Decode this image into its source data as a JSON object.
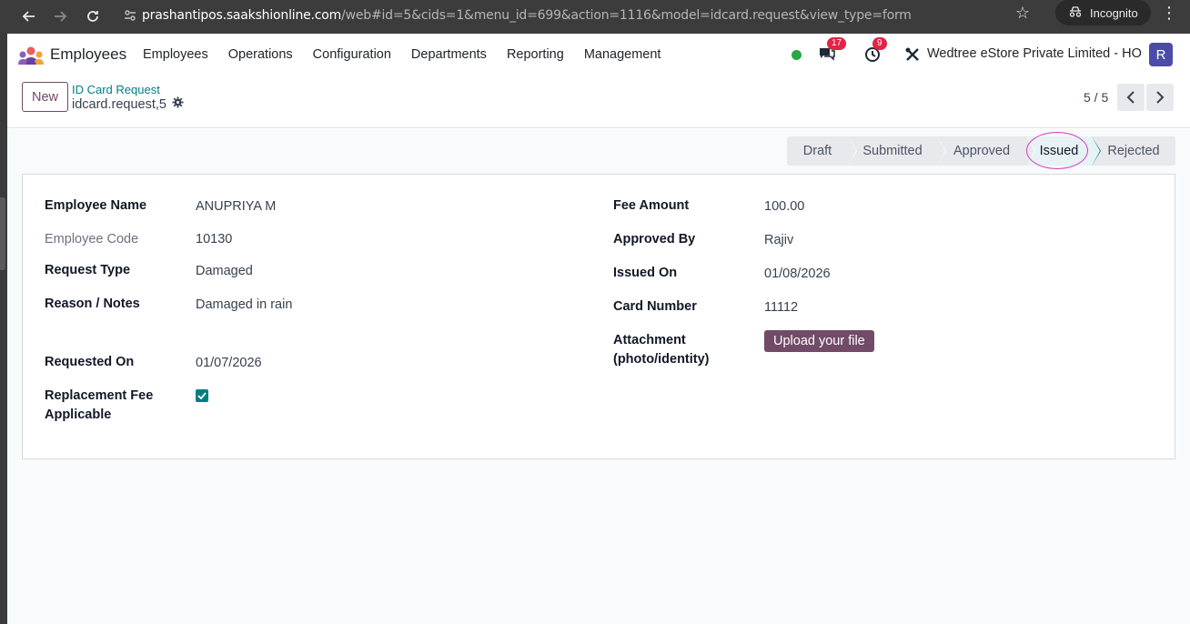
{
  "browser": {
    "url_host": "prashantipos.saakshionline.com",
    "url_path": "/web#id=5&cids=1&menu_id=699&action=1116&model=idcard.request&view_type=form",
    "incognito_label": "Incognito"
  },
  "navbar": {
    "app_name": "Employees",
    "menu": [
      "Employees",
      "Operations",
      "Configuration",
      "Departments",
      "Reporting",
      "Management"
    ],
    "messages_count": "17",
    "activities_count": "9",
    "company": "Wedtree eStore Private Limited - HO",
    "avatar_letter": "R"
  },
  "control_panel": {
    "new_label": "New",
    "breadcrumb": "ID Card Request",
    "record_name": "idcard.request,5",
    "pager": "5 / 5"
  },
  "statusbar": {
    "stages": [
      "Draft",
      "Submitted",
      "Approved",
      "Issued",
      "Rejected"
    ],
    "active": "Issued"
  },
  "form": {
    "left": {
      "employee_name_label": "Employee Name",
      "employee_name": "ANUPRIYA M",
      "employee_code_label": "Employee Code",
      "employee_code": "10130",
      "request_type_label": "Request Type",
      "request_type": "Damaged",
      "reason_label": "Reason / Notes",
      "reason": "Damaged in rain",
      "requested_on_label": "Requested On",
      "requested_on": "01/07/2026",
      "replacement_fee_label_1": "Replacement Fee",
      "replacement_fee_label_2": "Applicable",
      "replacement_fee_checked": true
    },
    "right": {
      "fee_amount_label": "Fee Amount",
      "fee_amount": "100.00",
      "approved_by_label": "Approved By",
      "approved_by": "Rajiv",
      "issued_on_label": "Issued On",
      "issued_on": "01/08/2026",
      "card_number_label": "Card Number",
      "card_number": "11112",
      "attachment_label_1": "Attachment",
      "attachment_label_2": "(photo/identity)",
      "upload_label": "Upload your file"
    }
  },
  "colors": {
    "brand": "#714b67",
    "accent": "#017e84",
    "badge": "#e02444",
    "highlight": "#d63bc9"
  }
}
